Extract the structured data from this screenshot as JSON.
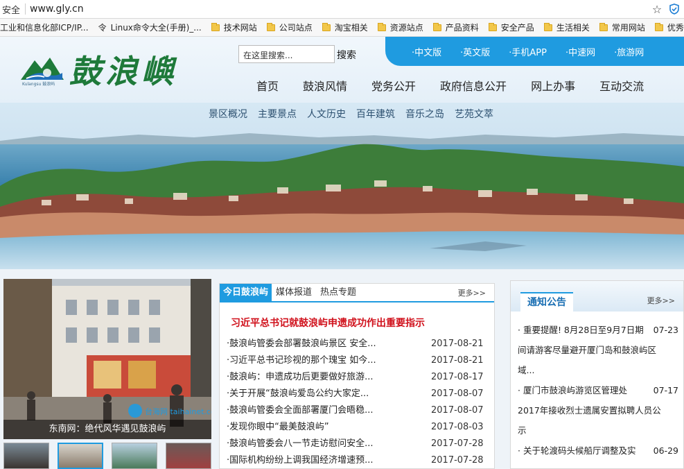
{
  "browser": {
    "security_label": "安全",
    "url": "www.gly.cn",
    "bookmarks": [
      {
        "label": "工业和信息化部ICP/IP...",
        "type": "page"
      },
      {
        "label": "Linux命令大全(手册)_...",
        "type": "page"
      },
      {
        "label": "技术网站",
        "type": "folder"
      },
      {
        "label": "公司站点",
        "type": "folder"
      },
      {
        "label": "淘宝相关",
        "type": "folder"
      },
      {
        "label": "资源站点",
        "type": "folder"
      },
      {
        "label": "产品资料",
        "type": "folder"
      },
      {
        "label": "安全产品",
        "type": "folder"
      },
      {
        "label": "生活相关",
        "type": "folder"
      },
      {
        "label": "常用网站",
        "type": "folder"
      },
      {
        "label": "优秀站点",
        "type": "folder"
      }
    ]
  },
  "header": {
    "logo_text": "鼓浪嶼",
    "logo_small": "Kulangsu 鼓浪屿",
    "search_placeholder": "在这里搜索...",
    "search_button": "搜索",
    "lang_links": [
      "·中文版",
      "·英文版",
      "·手机APP",
      "·中速网",
      "·旅游网"
    ],
    "main_nav": [
      "首页",
      "鼓浪风情",
      "党务公开",
      "政府信息公开",
      "网上办事",
      "互动交流"
    ]
  },
  "banner": {
    "sub_nav": [
      "景区概况",
      "主要景点",
      "人文历史",
      "百年建筑",
      "音乐之岛",
      "艺苑文萃"
    ]
  },
  "photo": {
    "caption": "东南网：绝代风华遇见鼓浪屿",
    "watermark": "台海网 taihainet.com"
  },
  "news": {
    "tabs": [
      "今日鼓浪屿",
      "媒体报道",
      "热点专题"
    ],
    "more": "更多>>",
    "headline": "习近平总书记就鼓浪屿申遗成功作出重要指示",
    "items": [
      {
        "title": "·鼓浪屿管委会部署鼓浪屿景区 安全...",
        "date": "2017-08-21"
      },
      {
        "title": "·习近平总书记珍视的那个瑰宝 如今...",
        "date": "2017-08-21"
      },
      {
        "title": "·鼓浪屿：申遗成功后更要做好旅游...",
        "date": "2017-08-17"
      },
      {
        "title": "·关于开展“鼓浪屿爱岛公约大家定...",
        "date": "2017-08-07"
      },
      {
        "title": "·鼓浪屿管委会全面部署厦门会晤稳...",
        "date": "2017-08-07"
      },
      {
        "title": "·发现你眼中“最美鼓浪屿”",
        "date": "2017-08-03"
      },
      {
        "title": "·鼓浪屿管委会八一节走访慰问安全...",
        "date": "2017-07-28"
      },
      {
        "title": "·国际机构纷纷上调我国经济增速预...",
        "date": "2017-07-28"
      }
    ]
  },
  "notice": {
    "title": "通知公告",
    "more": "更多>>",
    "items": [
      {
        "title": "· 重要提醒! 8月28日至9月7日期",
        "date": "07-23",
        "cont": [
          "间请游客尽量避开厦门岛和鼓浪屿区",
          "域..."
        ]
      },
      {
        "title": "· 厦门市鼓浪屿游览区管理处",
        "date": "07-17",
        "cont": [
          "2017年接收烈士遗属安置拟聘人员公",
          "示"
        ]
      },
      {
        "title": "· 关于轮渡码头候船厅调整及实",
        "date": "06-29",
        "cont": []
      }
    ]
  }
}
